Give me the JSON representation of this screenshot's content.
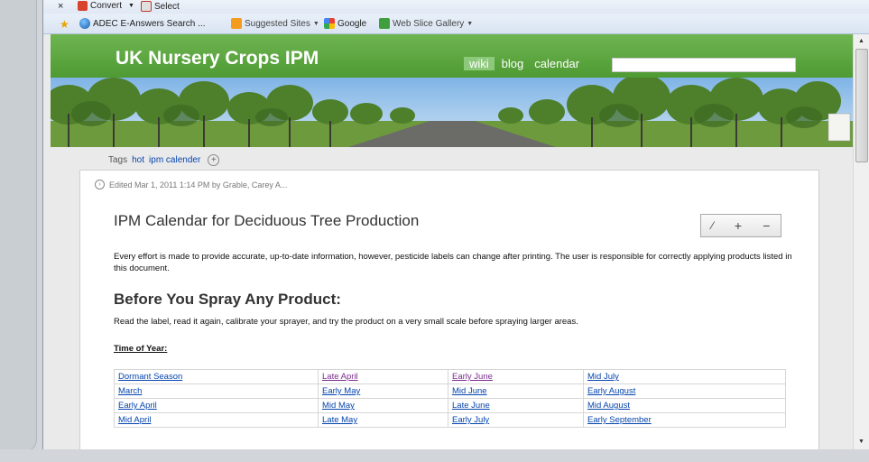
{
  "toolbar": {
    "close_glyph": "×",
    "convert_label": "Convert",
    "select_label": "Select"
  },
  "favorites": {
    "items": [
      {
        "label": "ADEC E-Answers Search ...",
        "icon": "globe-icon"
      },
      {
        "label": "Suggested Sites",
        "icon": "suggested-sites-icon"
      },
      {
        "label": "Google",
        "icon": "google-icon"
      },
      {
        "label": "Web Slice Gallery",
        "icon": "web-slice-icon"
      }
    ]
  },
  "site": {
    "title": "UK Nursery Crops IPM",
    "nav": [
      "wiki",
      "blog",
      "calendar"
    ],
    "search_value": ""
  },
  "tags": {
    "label": "Tags",
    "items": [
      "hot",
      "ipm calender"
    ]
  },
  "page": {
    "edited": "Edited Mar 1, 2011 1:14 PM by Grable, Carey A...",
    "title": "IPM Calendar for Deciduous Tree Production",
    "intro": "Every effort is made to provide accurate, up-to-date information, however, pesticide labels can change after printing. The user is responsible for correctly applying products listed in this document.",
    "heading": "Before You Spray Any Product:",
    "advice": "Read the label, read it again, calibrate your sprayer, and try the product on a very small scale before spraying larger areas.",
    "time_of_year": "Time of Year:",
    "calendar": [
      [
        "Dormant Season",
        "Late April",
        "Early June",
        "Mid July"
      ],
      [
        "March",
        "Early May",
        "Mid June",
        "Early August"
      ],
      [
        "Early April",
        "Mid May",
        "Late June",
        "Mid August"
      ],
      [
        "Mid April",
        "Late May",
        "Early July",
        "Early September"
      ]
    ]
  },
  "colors": {
    "header_green": "#5aa63e",
    "link_blue": "#0645ad",
    "visited_purple": "#7b2c8c"
  }
}
